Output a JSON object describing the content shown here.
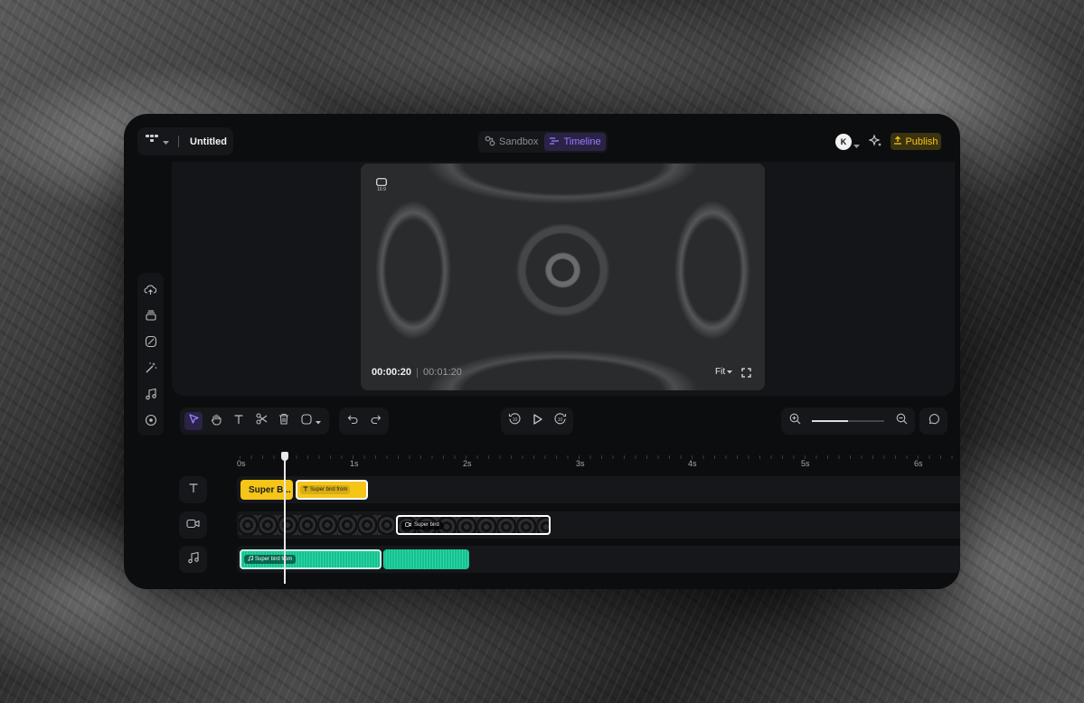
{
  "header": {
    "project_title": "Untitled",
    "modes": [
      {
        "label": "Sandbox",
        "active": false
      },
      {
        "label": "Timeline",
        "active": true
      }
    ],
    "avatar_initial": "K",
    "publish_label": "Publish"
  },
  "preview": {
    "aspect_ratio": "16:9",
    "current_time": "00:00:20",
    "total_time": "00:01:20",
    "fit_label": "Fit"
  },
  "ruler": {
    "ticks": [
      "0s",
      "1s",
      "2s",
      "3s",
      "4s",
      "5s",
      "6s"
    ]
  },
  "tracks": {
    "text_clip_a": "Super B...",
    "text_clip_b": "Super bird from",
    "video_clip_b": "Super bird",
    "audio_clip_a": "Super bird from"
  },
  "zoom": {
    "level": 0.5
  },
  "colors": {
    "accent": "#9b7cff",
    "publish": "#f5c518",
    "text_clip": "#f5c518",
    "audio_clip": "#16c08f"
  }
}
